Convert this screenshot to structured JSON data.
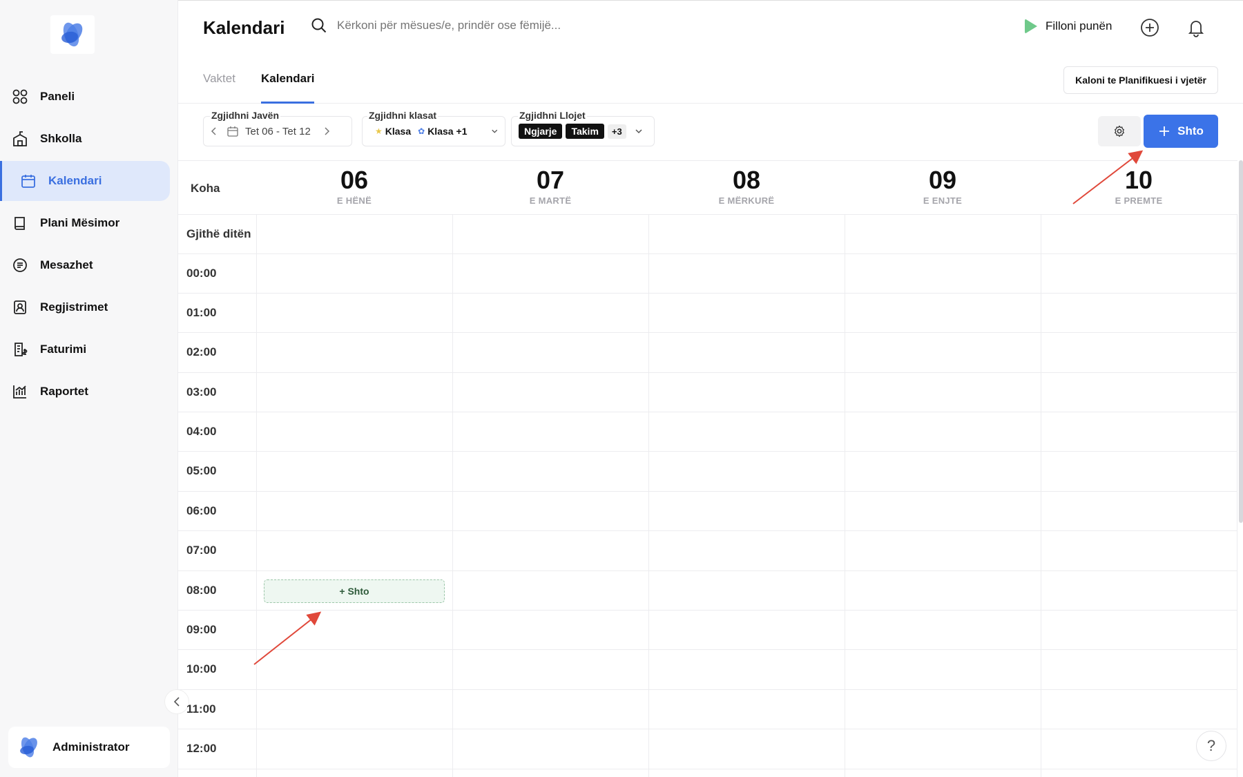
{
  "sidebar": {
    "items": [
      {
        "label": "Paneli",
        "icon": "grid-icon"
      },
      {
        "label": "Shkolla",
        "icon": "school-icon"
      },
      {
        "label": "Kalendari",
        "icon": "calendar-icon",
        "active": true
      },
      {
        "label": "Plani Mësimor",
        "icon": "book-icon"
      },
      {
        "label": "Mesazhet",
        "icon": "message-icon"
      },
      {
        "label": "Regjistrimet",
        "icon": "id-card-icon"
      },
      {
        "label": "Faturimi",
        "icon": "invoice-icon"
      },
      {
        "label": "Raportet",
        "icon": "chart-icon"
      }
    ],
    "user": {
      "name": "Administrator"
    }
  },
  "header": {
    "title": "Kalendari",
    "search_placeholder": "Kërkoni për mësues/e, prindër ose fëmijë...",
    "start_work_label": "Filloni punën"
  },
  "tabs": {
    "items": [
      "Vaktet",
      "Kalendari"
    ],
    "active": "Kalendari",
    "old_planner_label": "Kaloni te Planifikuesi i vjetër"
  },
  "filters": {
    "week_label": "Zgjidhni Javën",
    "week_value": "Tet 06 - Tet 12",
    "classes_label": "Zgjidhni klasat",
    "class_1": "Klasa",
    "class_2": "Klasa",
    "classes_more": "+1",
    "types_label": "Zgjidhni Llojet",
    "type_1": "Ngjarje",
    "type_2": "Takim",
    "types_more": "+3",
    "add_label": "Shto"
  },
  "calendar": {
    "time_header": "Koha",
    "days": [
      {
        "num": "06",
        "weekday": "E HËNË"
      },
      {
        "num": "07",
        "weekday": "E MARTË"
      },
      {
        "num": "08",
        "weekday": "E MËRKURË"
      },
      {
        "num": "09",
        "weekday": "E ENJTE"
      },
      {
        "num": "10",
        "weekday": "E PREMTE"
      }
    ],
    "all_day_label": "Gjithë ditën",
    "times": [
      "00:00",
      "01:00",
      "02:00",
      "03:00",
      "04:00",
      "05:00",
      "06:00",
      "07:00",
      "08:00",
      "09:00",
      "10:00",
      "11:00",
      "12:00"
    ],
    "slot_add_label": "+ Shto"
  },
  "colors": {
    "accent": "#3b73e8",
    "annotation_arrow": "#e0483a",
    "play": "#6fc98a"
  }
}
